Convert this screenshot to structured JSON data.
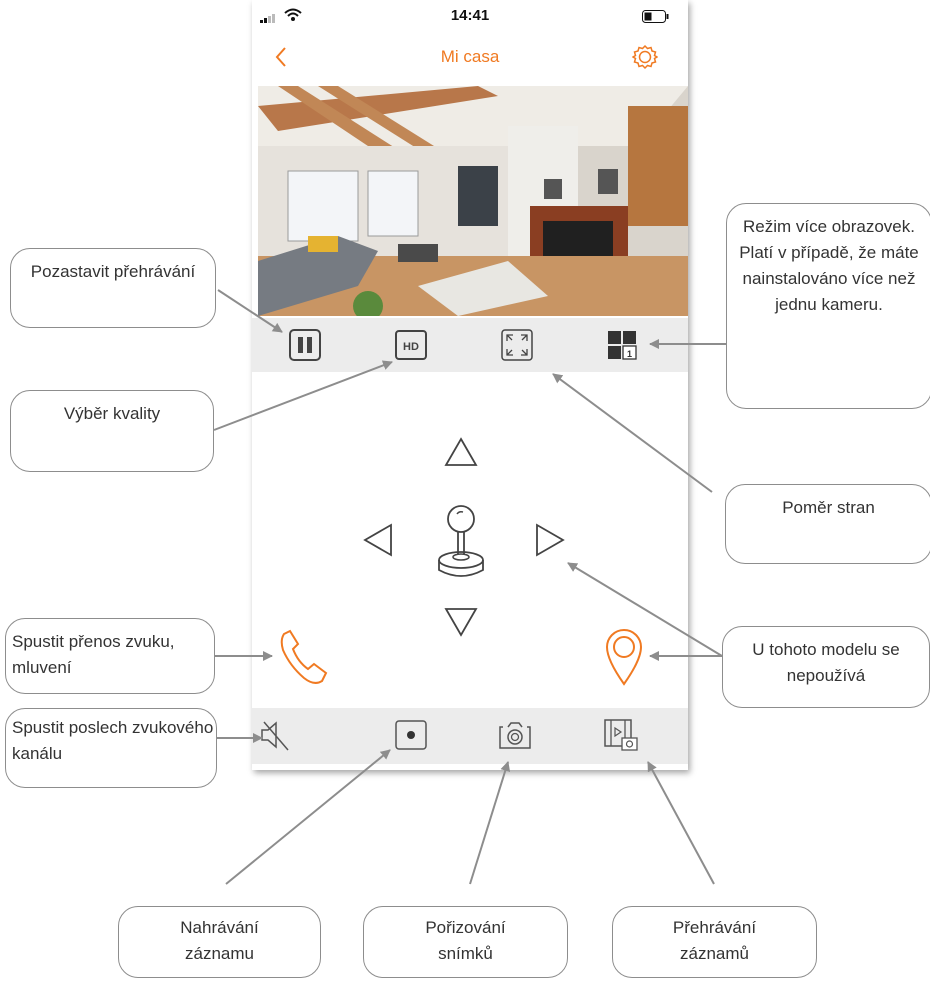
{
  "status_bar": {
    "time": "14:41"
  },
  "nav": {
    "title": "Mi casa",
    "back_icon": "chevron-left-icon",
    "settings_icon": "gear-icon"
  },
  "control_bar": {
    "pause_icon": "pause-icon",
    "quality_label": "HD",
    "fullscreen_icon": "fullscreen-icon",
    "multiscreen_label": "1"
  },
  "bottom_bar": {
    "mute_icon": "speaker-mute-icon",
    "record_icon": "record-icon",
    "snapshot_icon": "camera-icon",
    "playback_icon": "film-camera-icon"
  },
  "colors": {
    "accent": "#f07a22",
    "bar": "#ececec",
    "icon": "#444444",
    "callout_border": "#8d8d8d"
  },
  "callouts": {
    "pause": "Pozastavit přehrávání",
    "quality": "Výběr kvality",
    "multiscreen": "Režim více obrazovek. Platí v případě, že máte nainstalováno více než jednu kameru.",
    "aspect": "Poměr stran",
    "talk": "Spustit přenos zvuku, mluvení",
    "unused": "U tohoto modelu se nepoužívá",
    "listen": "Spustit poslech zvukového kanálu",
    "record": "Nahrávání záznamu",
    "snapshot": "Pořizování snímků",
    "playback": "Přehrávání záznamů"
  }
}
